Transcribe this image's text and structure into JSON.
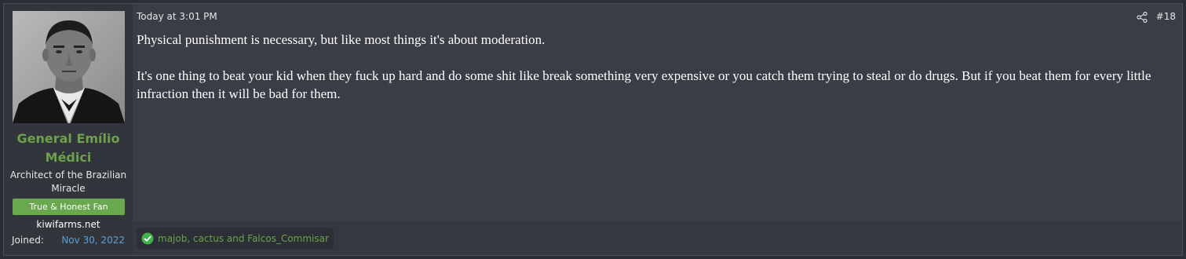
{
  "post": {
    "timestamp": "Today at 3:01 PM",
    "post_number": "#18",
    "paragraphs": [
      "Physical punishment is necessary, but like most things it's about moderation.",
      "It's one thing to beat your kid when they fuck up hard and do some shit like break something very expensive or you catch them trying to steal or do drugs. But if you beat them for every little infraction then it will be bad for them."
    ],
    "reactions_text": "majob, cactus and Falcos_Commisar"
  },
  "user": {
    "name": "General Emílio Médici",
    "title": "Architect of the Brazilian Miracle",
    "banner": "True & Honest Fan",
    "site": "kiwifarms.net",
    "joined_label": "Joined:",
    "joined_value": "Nov 30, 2022"
  },
  "icons": {
    "share": "share-icon",
    "reaction": "check-circle-icon"
  },
  "colors": {
    "username": "#6da04b",
    "banner_bg": "#6aa84f",
    "joined_date": "#5f9fd6",
    "post_bg": "#3a3d45",
    "user_cell_bg": "#32353b"
  }
}
